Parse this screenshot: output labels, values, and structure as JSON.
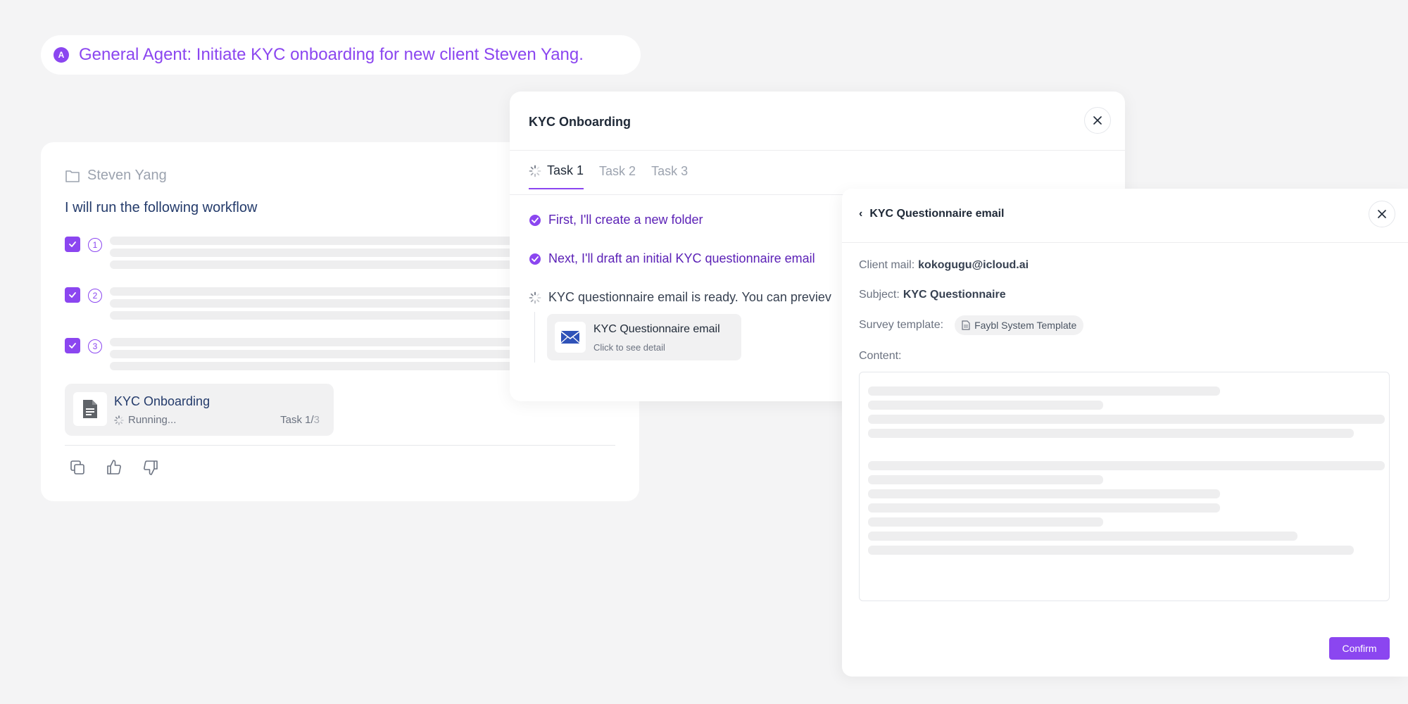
{
  "prompt": {
    "avatar": "A",
    "text": "General Agent: Initiate KYC onboarding for new client Steven Yang."
  },
  "chat": {
    "folder_name": "Steven Yang",
    "intro": "I will run the following workflow",
    "steps": [
      {
        "number": "1",
        "checked": true
      },
      {
        "number": "2",
        "checked": true
      },
      {
        "number": "3",
        "checked": true
      }
    ],
    "card": {
      "title": "KYC Onboarding",
      "status": "Running...",
      "task_prefix": "Task 1/",
      "task_total": "3"
    },
    "actions": [
      "copy-icon",
      "thumbs-up-icon",
      "thumbs-down-icon"
    ]
  },
  "modal": {
    "title": "KYC Onboarding",
    "tabs": [
      {
        "label": "Task 1",
        "active": true
      },
      {
        "label": "Task 2",
        "active": false
      },
      {
        "label": "Task 3",
        "active": false
      }
    ],
    "steps": [
      {
        "text": "First, I'll create a new folder",
        "state": "done"
      },
      {
        "text": "Next, I'll draft an initial KYC questionnaire email",
        "state": "done"
      },
      {
        "text": "KYC questionnaire email is ready. You can previev",
        "state": "running"
      }
    ],
    "email_card": {
      "title": "KYC Questionnaire email",
      "subtitle": "Click to see detail"
    }
  },
  "detail": {
    "title": "KYC Questionnaire email",
    "client_mail_label": "Client mail:",
    "client_mail": "kokogugu@icloud.ai",
    "subject_label": "Subject:",
    "subject": "KYC Questionnaire",
    "survey_label": "Survey template:",
    "survey_template": "Faybl System Template",
    "content_label": "Content:",
    "confirm_label": "Confirm"
  },
  "colors": {
    "accent": "#8b46f0",
    "done_text": "#5b21b6",
    "background": "#f4f4f5"
  }
}
